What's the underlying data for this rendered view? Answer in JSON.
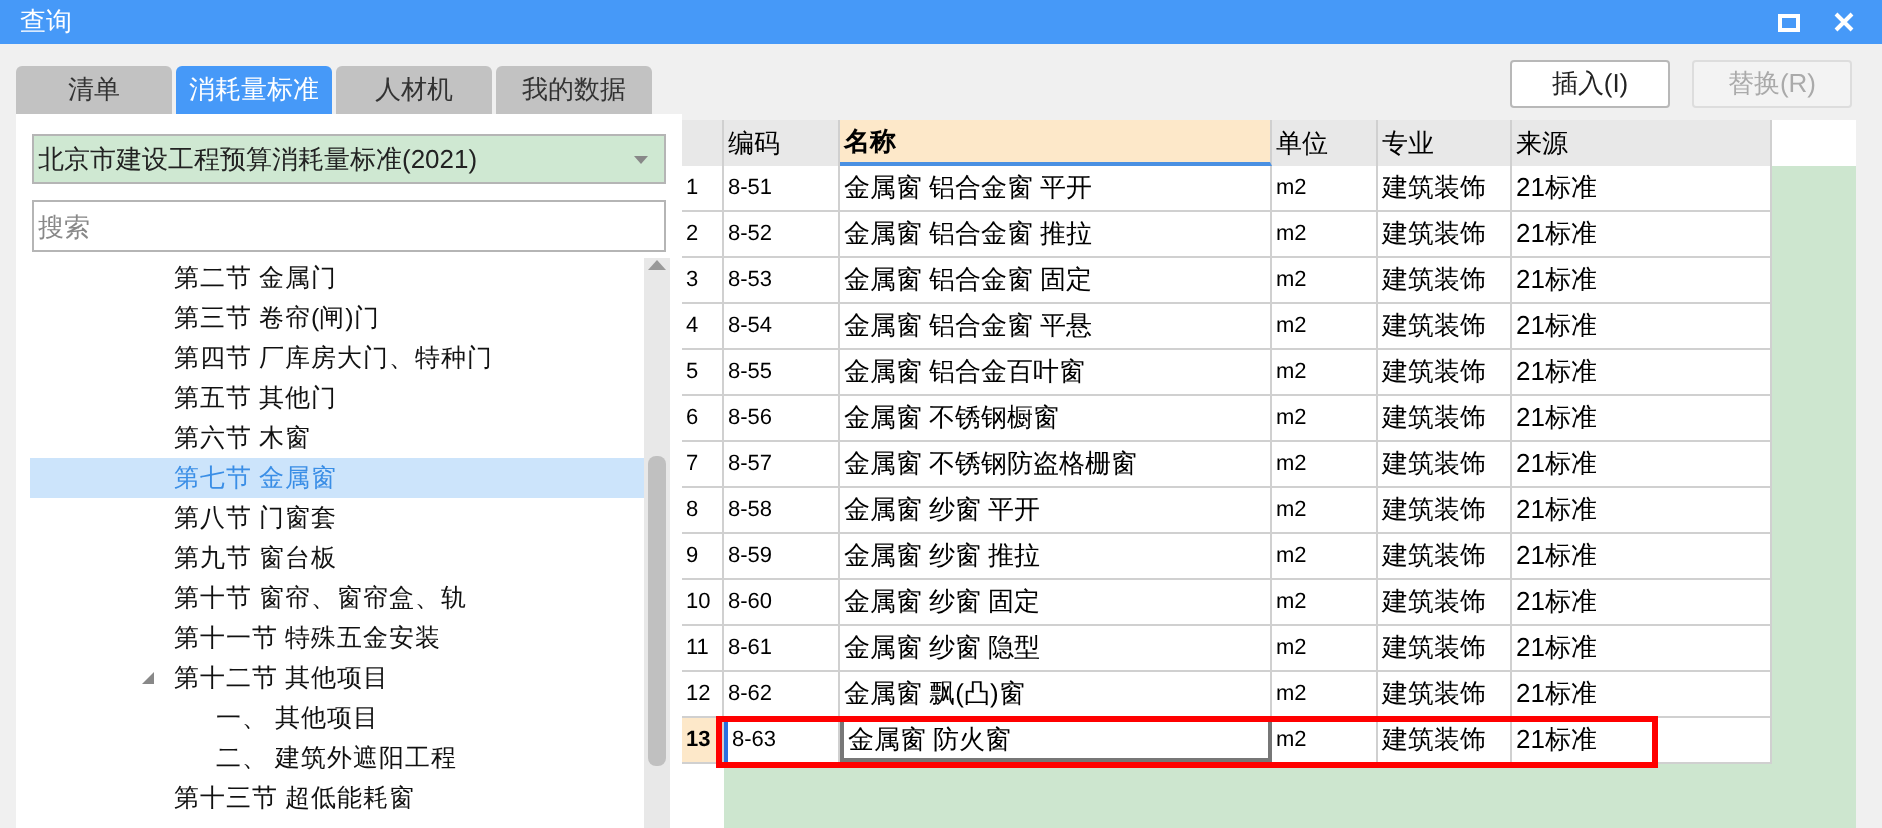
{
  "window": {
    "title": "查询"
  },
  "tabs": [
    {
      "label": "清单",
      "selected": false
    },
    {
      "label": "消耗量标准",
      "selected": true
    },
    {
      "label": "人材机",
      "selected": false
    },
    {
      "label": "我的数据",
      "selected": false
    }
  ],
  "standard_dropdown": {
    "value": "北京市建设工程预算消耗量标准(2021)"
  },
  "search": {
    "placeholder": "搜索"
  },
  "tree": [
    {
      "label": "第二节 金属门",
      "selected": false
    },
    {
      "label": "第三节 卷帘(闸)门",
      "selected": false
    },
    {
      "label": "第四节 厂库房大门、特种门",
      "selected": false
    },
    {
      "label": "第五节 其他门",
      "selected": false
    },
    {
      "label": "第六节 木窗",
      "selected": false
    },
    {
      "label": "第七节 金属窗",
      "selected": true
    },
    {
      "label": "第八节 门窗套",
      "selected": false
    },
    {
      "label": "第九节 窗台板",
      "selected": false
    },
    {
      "label": "第十节 窗帘、窗帘盒、轨",
      "selected": false
    },
    {
      "label": "第十一节 特殊五金安装",
      "selected": false
    },
    {
      "label": "第十二节 其他项目",
      "selected": false,
      "expanded": true,
      "children": [
        {
          "label": "一、 其他项目",
          "selected": false
        },
        {
          "label": "二、 建筑外遮阳工程",
          "selected": false
        }
      ]
    },
    {
      "label": "第十三节 超低能耗窗",
      "selected": false
    }
  ],
  "buttons": [
    {
      "label": "插入(I)",
      "disabled": false
    },
    {
      "label": "替换(R)",
      "disabled": true
    }
  ],
  "table": {
    "columns": [
      {
        "label": "编码",
        "selected": false
      },
      {
        "label": "名称",
        "selected": true
      },
      {
        "label": "单位",
        "selected": false
      },
      {
        "label": "专业",
        "selected": false
      },
      {
        "label": "来源",
        "selected": false
      }
    ],
    "rows": [
      {
        "number": "1",
        "code": "8-51",
        "name": "金属窗 铝合金窗 平开",
        "unit": "m2",
        "major": "建筑装饰",
        "source": "21标准",
        "selected": false,
        "outlined": false
      },
      {
        "number": "2",
        "code": "8-52",
        "name": "金属窗 铝合金窗 推拉",
        "unit": "m2",
        "major": "建筑装饰",
        "source": "21标准",
        "selected": false,
        "outlined": false
      },
      {
        "number": "3",
        "code": "8-53",
        "name": "金属窗 铝合金窗 固定",
        "unit": "m2",
        "major": "建筑装饰",
        "source": "21标准",
        "selected": false,
        "outlined": false
      },
      {
        "number": "4",
        "code": "8-54",
        "name": "金属窗 铝合金窗 平悬",
        "unit": "m2",
        "major": "建筑装饰",
        "source": "21标准",
        "selected": false,
        "outlined": false
      },
      {
        "number": "5",
        "code": "8-55",
        "name": "金属窗 铝合金百叶窗",
        "unit": "m2",
        "major": "建筑装饰",
        "source": "21标准",
        "selected": false,
        "outlined": false
      },
      {
        "number": "6",
        "code": "8-56",
        "name": "金属窗 不锈钢橱窗",
        "unit": "m2",
        "major": "建筑装饰",
        "source": "21标准",
        "selected": false,
        "outlined": false
      },
      {
        "number": "7",
        "code": "8-57",
        "name": "金属窗 不锈钢防盗格栅窗",
        "unit": "m2",
        "major": "建筑装饰",
        "source": "21标准",
        "selected": false,
        "outlined": false
      },
      {
        "number": "8",
        "code": "8-58",
        "name": "金属窗 纱窗 平开",
        "unit": "m2",
        "major": "建筑装饰",
        "source": "21标准",
        "selected": false,
        "outlined": false
      },
      {
        "number": "9",
        "code": "8-59",
        "name": "金属窗 纱窗 推拉",
        "unit": "m2",
        "major": "建筑装饰",
        "source": "21标准",
        "selected": false,
        "outlined": false
      },
      {
        "number": "10",
        "code": "8-60",
        "name": "金属窗 纱窗 固定",
        "unit": "m2",
        "major": "建筑装饰",
        "source": "21标准",
        "selected": false,
        "outlined": false
      },
      {
        "number": "11",
        "code": "8-61",
        "name": "金属窗 纱窗 隐型",
        "unit": "m2",
        "major": "建筑装饰",
        "source": "21标准",
        "selected": false,
        "outlined": false
      },
      {
        "number": "12",
        "code": "8-62",
        "name": "金属窗 飘(凸)窗",
        "unit": "m2",
        "major": "建筑装饰",
        "source": "21标准",
        "selected": false,
        "outlined": false
      },
      {
        "number": "13",
        "code": "8-63",
        "name": "金属窗 防火窗",
        "unit": "m2",
        "major": "建筑装饰",
        "source": "21标准",
        "selected": true,
        "outlined": true
      }
    ]
  }
}
